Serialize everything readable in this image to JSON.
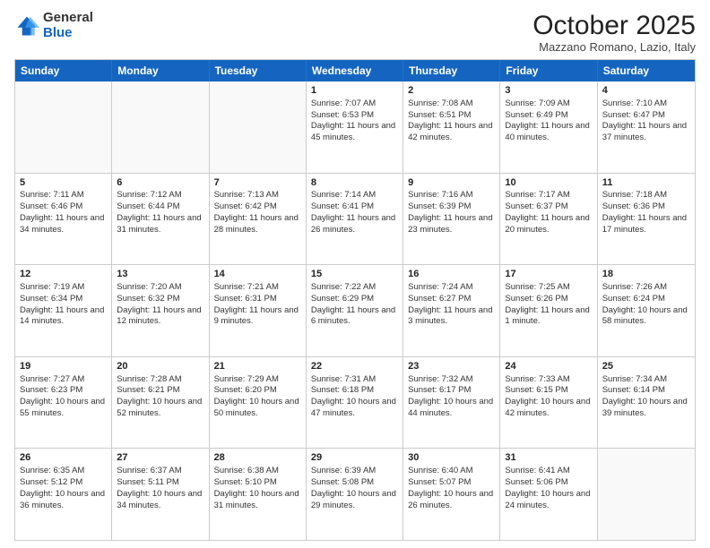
{
  "logo": {
    "general": "General",
    "blue": "Blue"
  },
  "title": "October 2025",
  "location": "Mazzano Romano, Lazio, Italy",
  "days": [
    "Sunday",
    "Monday",
    "Tuesday",
    "Wednesday",
    "Thursday",
    "Friday",
    "Saturday"
  ],
  "weeks": [
    [
      {
        "day": "",
        "info": ""
      },
      {
        "day": "",
        "info": ""
      },
      {
        "day": "",
        "info": ""
      },
      {
        "day": "1",
        "info": "Sunrise: 7:07 AM\nSunset: 6:53 PM\nDaylight: 11 hours and 45 minutes."
      },
      {
        "day": "2",
        "info": "Sunrise: 7:08 AM\nSunset: 6:51 PM\nDaylight: 11 hours and 42 minutes."
      },
      {
        "day": "3",
        "info": "Sunrise: 7:09 AM\nSunset: 6:49 PM\nDaylight: 11 hours and 40 minutes."
      },
      {
        "day": "4",
        "info": "Sunrise: 7:10 AM\nSunset: 6:47 PM\nDaylight: 11 hours and 37 minutes."
      }
    ],
    [
      {
        "day": "5",
        "info": "Sunrise: 7:11 AM\nSunset: 6:46 PM\nDaylight: 11 hours and 34 minutes."
      },
      {
        "day": "6",
        "info": "Sunrise: 7:12 AM\nSunset: 6:44 PM\nDaylight: 11 hours and 31 minutes."
      },
      {
        "day": "7",
        "info": "Sunrise: 7:13 AM\nSunset: 6:42 PM\nDaylight: 11 hours and 28 minutes."
      },
      {
        "day": "8",
        "info": "Sunrise: 7:14 AM\nSunset: 6:41 PM\nDaylight: 11 hours and 26 minutes."
      },
      {
        "day": "9",
        "info": "Sunrise: 7:16 AM\nSunset: 6:39 PM\nDaylight: 11 hours and 23 minutes."
      },
      {
        "day": "10",
        "info": "Sunrise: 7:17 AM\nSunset: 6:37 PM\nDaylight: 11 hours and 20 minutes."
      },
      {
        "day": "11",
        "info": "Sunrise: 7:18 AM\nSunset: 6:36 PM\nDaylight: 11 hours and 17 minutes."
      }
    ],
    [
      {
        "day": "12",
        "info": "Sunrise: 7:19 AM\nSunset: 6:34 PM\nDaylight: 11 hours and 14 minutes."
      },
      {
        "day": "13",
        "info": "Sunrise: 7:20 AM\nSunset: 6:32 PM\nDaylight: 11 hours and 12 minutes."
      },
      {
        "day": "14",
        "info": "Sunrise: 7:21 AM\nSunset: 6:31 PM\nDaylight: 11 hours and 9 minutes."
      },
      {
        "day": "15",
        "info": "Sunrise: 7:22 AM\nSunset: 6:29 PM\nDaylight: 11 hours and 6 minutes."
      },
      {
        "day": "16",
        "info": "Sunrise: 7:24 AM\nSunset: 6:27 PM\nDaylight: 11 hours and 3 minutes."
      },
      {
        "day": "17",
        "info": "Sunrise: 7:25 AM\nSunset: 6:26 PM\nDaylight: 11 hours and 1 minute."
      },
      {
        "day": "18",
        "info": "Sunrise: 7:26 AM\nSunset: 6:24 PM\nDaylight: 10 hours and 58 minutes."
      }
    ],
    [
      {
        "day": "19",
        "info": "Sunrise: 7:27 AM\nSunset: 6:23 PM\nDaylight: 10 hours and 55 minutes."
      },
      {
        "day": "20",
        "info": "Sunrise: 7:28 AM\nSunset: 6:21 PM\nDaylight: 10 hours and 52 minutes."
      },
      {
        "day": "21",
        "info": "Sunrise: 7:29 AM\nSunset: 6:20 PM\nDaylight: 10 hours and 50 minutes."
      },
      {
        "day": "22",
        "info": "Sunrise: 7:31 AM\nSunset: 6:18 PM\nDaylight: 10 hours and 47 minutes."
      },
      {
        "day": "23",
        "info": "Sunrise: 7:32 AM\nSunset: 6:17 PM\nDaylight: 10 hours and 44 minutes."
      },
      {
        "day": "24",
        "info": "Sunrise: 7:33 AM\nSunset: 6:15 PM\nDaylight: 10 hours and 42 minutes."
      },
      {
        "day": "25",
        "info": "Sunrise: 7:34 AM\nSunset: 6:14 PM\nDaylight: 10 hours and 39 minutes."
      }
    ],
    [
      {
        "day": "26",
        "info": "Sunrise: 6:35 AM\nSunset: 5:12 PM\nDaylight: 10 hours and 36 minutes."
      },
      {
        "day": "27",
        "info": "Sunrise: 6:37 AM\nSunset: 5:11 PM\nDaylight: 10 hours and 34 minutes."
      },
      {
        "day": "28",
        "info": "Sunrise: 6:38 AM\nSunset: 5:10 PM\nDaylight: 10 hours and 31 minutes."
      },
      {
        "day": "29",
        "info": "Sunrise: 6:39 AM\nSunset: 5:08 PM\nDaylight: 10 hours and 29 minutes."
      },
      {
        "day": "30",
        "info": "Sunrise: 6:40 AM\nSunset: 5:07 PM\nDaylight: 10 hours and 26 minutes."
      },
      {
        "day": "31",
        "info": "Sunrise: 6:41 AM\nSunset: 5:06 PM\nDaylight: 10 hours and 24 minutes."
      },
      {
        "day": "",
        "info": ""
      }
    ]
  ]
}
